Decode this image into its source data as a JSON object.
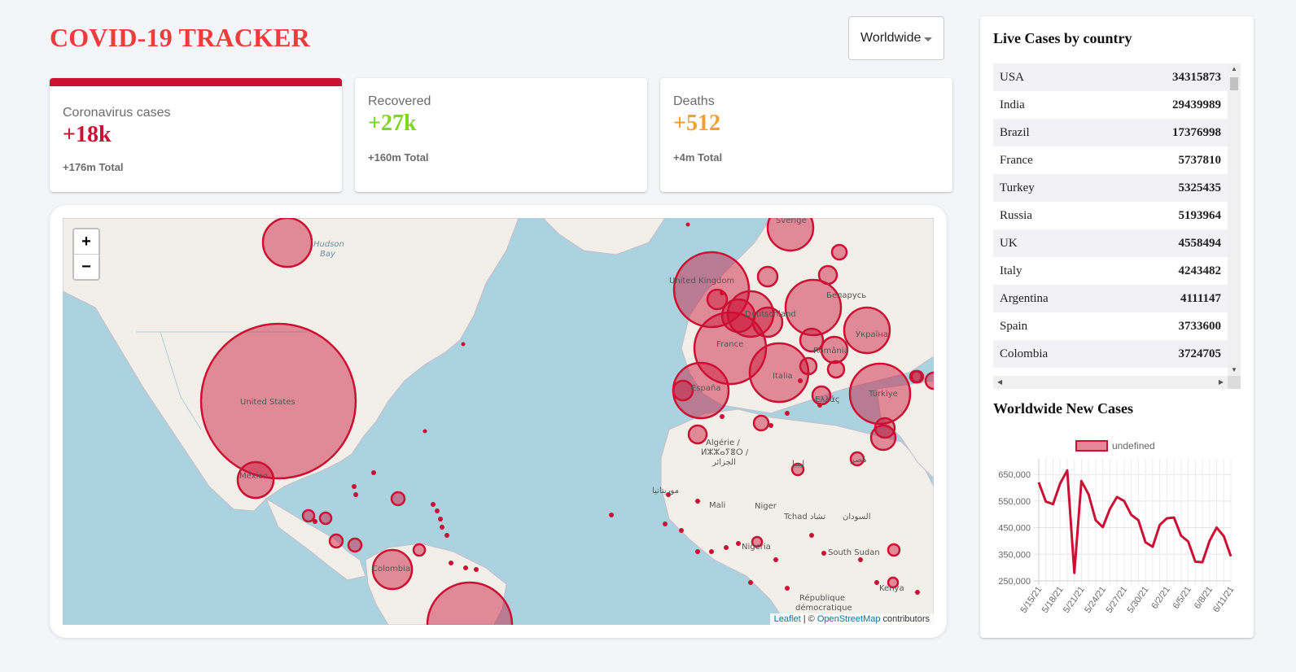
{
  "header": {
    "title": "COVID-19 TRACKER",
    "selected_country": "Worldwide"
  },
  "colors": {
    "title": "#ee3c3c",
    "cases_accent": "#cc1034",
    "recovered": "#7dd71d",
    "deaths": "#f0a030",
    "circle_fill": "#cc1034"
  },
  "cards": [
    {
      "label": "Coronavirus cases",
      "value": "+18k",
      "total": "+176m Total",
      "selected": true
    },
    {
      "label": "Recovered",
      "value": "+27k",
      "total": "+160m Total",
      "selected": false
    },
    {
      "label": "Deaths",
      "value": "+512",
      "total": "+4m Total",
      "selected": false
    }
  ],
  "map": {
    "zoom_in": "+",
    "zoom_out": "−",
    "attribution_leaflet": "Leaflet",
    "attribution_sep": " | © ",
    "attribution_osm": "OpenStreetMap",
    "attribution_tail": " contributors",
    "labels": [
      "Hudson",
      "Bay",
      "United States",
      "México",
      "Colombia",
      "United Kingdom",
      "France",
      "España",
      "Italia",
      "Deutschland",
      "Беларусь",
      "Україна",
      "România",
      "Türkiye",
      "Ελλάς",
      "Algérie /",
      "ⵍⵣⵣⴰⵢⴻⵔ /",
      "الجزائر",
      "Mali",
      "Niger",
      "Tchad تشاد",
      "السودان",
      "Nigeria",
      "South Sudan",
      "République",
      "démocratique",
      "Kenya",
      "موريتانيا",
      "ليبيا",
      "مصر",
      "Sverige"
    ]
  },
  "live_table": {
    "title": "Live Cases by country",
    "rows": [
      {
        "country": "USA",
        "cases": "34315873"
      },
      {
        "country": "India",
        "cases": "29439989"
      },
      {
        "country": "Brazil",
        "cases": "17376998"
      },
      {
        "country": "France",
        "cases": "5737810"
      },
      {
        "country": "Turkey",
        "cases": "5325435"
      },
      {
        "country": "Russia",
        "cases": "5193964"
      },
      {
        "country": "UK",
        "cases": "4558494"
      },
      {
        "country": "Italy",
        "cases": "4243482"
      },
      {
        "country": "Argentina",
        "cases": "4111147"
      },
      {
        "country": "Spain",
        "cases": "3733600"
      },
      {
        "country": "Colombia",
        "cases": "3724705"
      }
    ]
  },
  "chart_data": {
    "type": "line",
    "title": "Worldwide New Cases",
    "legend": "undefined",
    "legend_position": "top",
    "grid": true,
    "x": [
      "5/15/21",
      "5/16/21",
      "5/17/21",
      "5/18/21",
      "5/19/21",
      "5/20/21",
      "5/21/21",
      "5/22/21",
      "5/23/21",
      "5/24/21",
      "5/25/21",
      "5/26/21",
      "5/27/21",
      "5/28/21",
      "5/29/21",
      "5/30/21",
      "5/31/21",
      "6/1/21",
      "6/2/21",
      "6/3/21",
      "6/4/21",
      "6/5/21",
      "6/6/21",
      "6/7/21",
      "6/8/21",
      "6/9/21",
      "6/10/21",
      "6/11/21"
    ],
    "x_tick_labels": [
      "5/15/21",
      "5/18/21",
      "5/21/21",
      "5/24/21",
      "5/27/21",
      "5/30/21",
      "6/2/21",
      "6/5/21",
      "6/8/21",
      "6/11/21"
    ],
    "values": [
      620000,
      548000,
      538000,
      615000,
      665000,
      280000,
      625000,
      575000,
      478000,
      452000,
      520000,
      565000,
      550000,
      498000,
      478000,
      395000,
      378000,
      460000,
      485000,
      488000,
      420000,
      398000,
      322000,
      320000,
      400000,
      450000,
      418000,
      342000
    ],
    "y_ticks": [
      250000,
      350000,
      450000,
      550000,
      650000
    ],
    "y_tick_labels": [
      "250,000",
      "350,000",
      "450,000",
      "550,000",
      "650,000"
    ],
    "ylim": [
      250000,
      690000
    ]
  }
}
